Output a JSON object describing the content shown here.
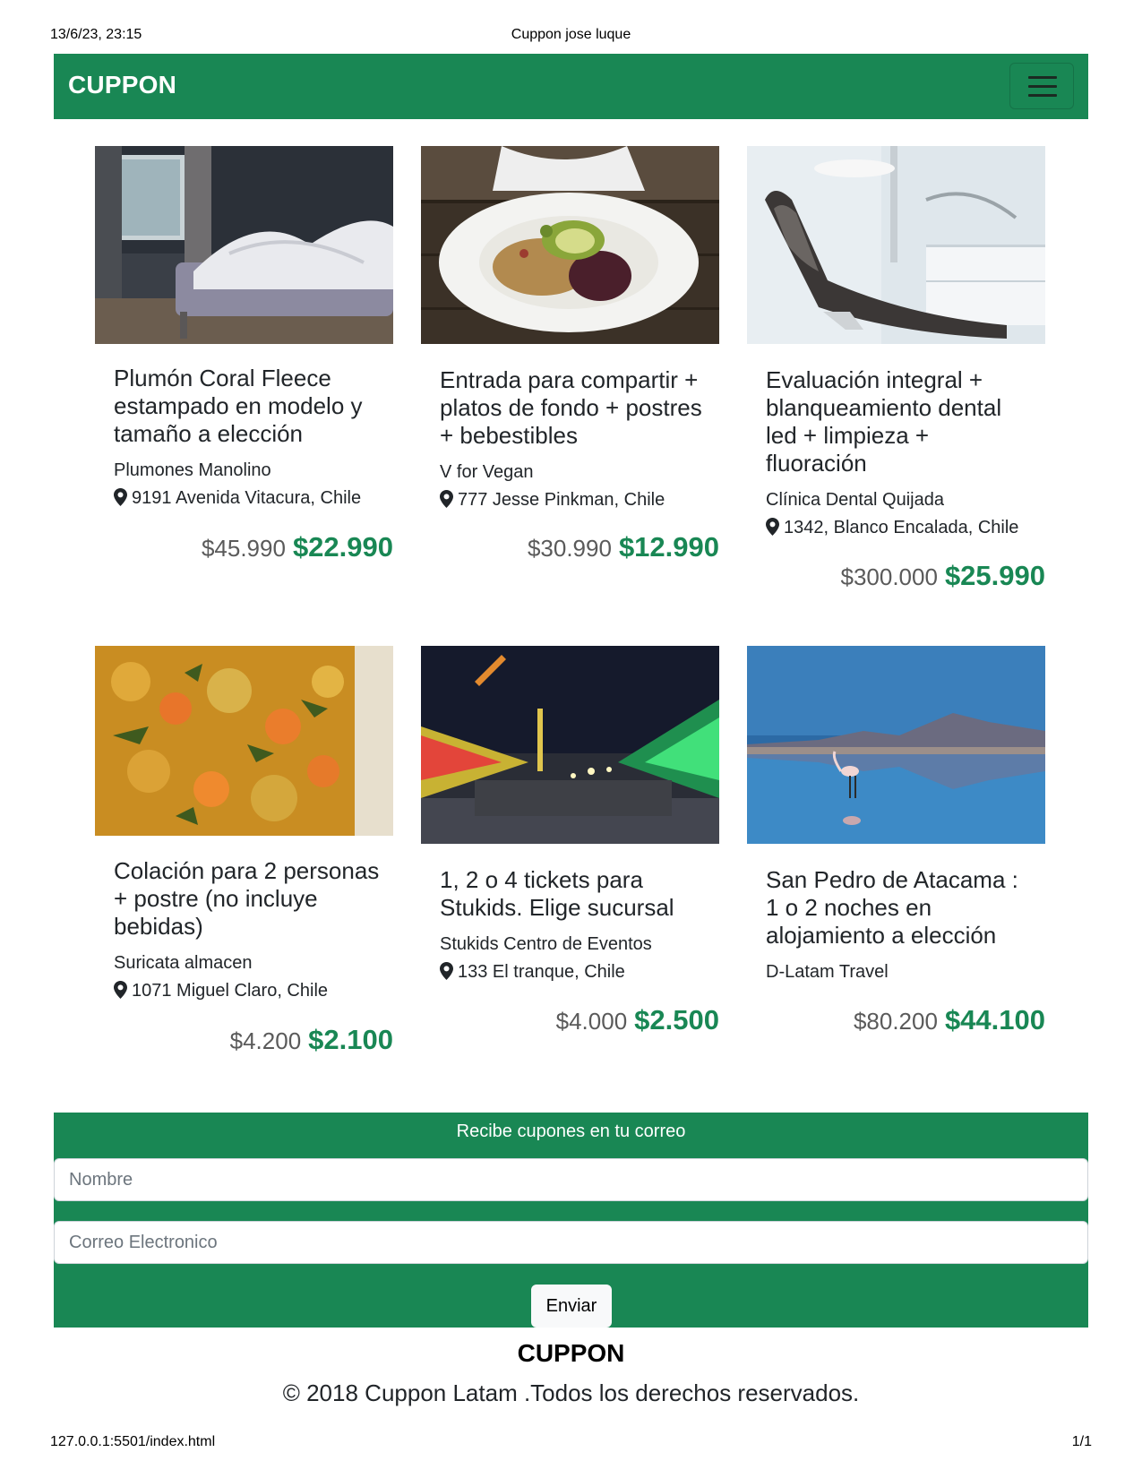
{
  "print": {
    "datetime": "13/6/23, 23:15",
    "page_title": "Cuppon jose luque",
    "url": "127.0.0.1:5501/index.html",
    "page_count": "1/1"
  },
  "navbar": {
    "brand": "CUPPON",
    "toggler_icon": "hamburger-menu-icon"
  },
  "cards": [
    {
      "title": "Plumón Coral Fleece estampado en modelo y tamaño a elección",
      "vendor": "Plumones Manolino",
      "address": "9191 Avenida Vitacura, Chile",
      "old_price": "$45.990",
      "new_price": "$22.990",
      "image": "bedroom-photo"
    },
    {
      "title": "Entrada para compartir + platos de fondo + postres + bebestibles",
      "vendor": "V for Vegan",
      "address": "777 Jesse Pinkman, Chile",
      "old_price": "$30.990",
      "new_price": "$12.990",
      "image": "vegan-salad-photo"
    },
    {
      "title": "Evaluación integral + blanqueamiento dental led + limpieza + fluoración",
      "vendor": "Clínica Dental Quijada",
      "address": "1342, Blanco Encalada, Chile",
      "old_price": "$300.000",
      "new_price": "$25.990",
      "image": "dental-chair-photo"
    },
    {
      "title": "Colación para 2 personas + postre (no incluye bebidas)",
      "vendor": "Suricata almacen",
      "address": "1071 Miguel Claro, Chile",
      "old_price": "$4.200",
      "new_price": "$2.100",
      "image": "food-dish-photo"
    },
    {
      "title": "1, 2 o 4 tickets para Stukids. Elige sucursal",
      "vendor": "Stukids Centro de Eventos",
      "address": "133 El tranque, Chile",
      "old_price": "$4.000",
      "new_price": "$2.500",
      "image": "fairground-photo"
    },
    {
      "title": "San Pedro de Atacama : 1 o 2 noches en alojamiento a elección",
      "vendor": "D-Latam Travel",
      "address": "",
      "old_price": "$80.200",
      "new_price": "$44.100",
      "image": "flamingo-lake-photo"
    }
  ],
  "subscribe": {
    "title": "Recibe cupones en tu correo",
    "name_placeholder": "Nombre",
    "email_placeholder": "Correo Electronico",
    "button": "Enviar"
  },
  "footer": {
    "brand": "CUPPON",
    "copyright": "© 2018 Cuppon Latam .Todos los derechos reservados."
  },
  "colors": {
    "brand_green": "#198754",
    "button_light": "#f8f9fa"
  }
}
